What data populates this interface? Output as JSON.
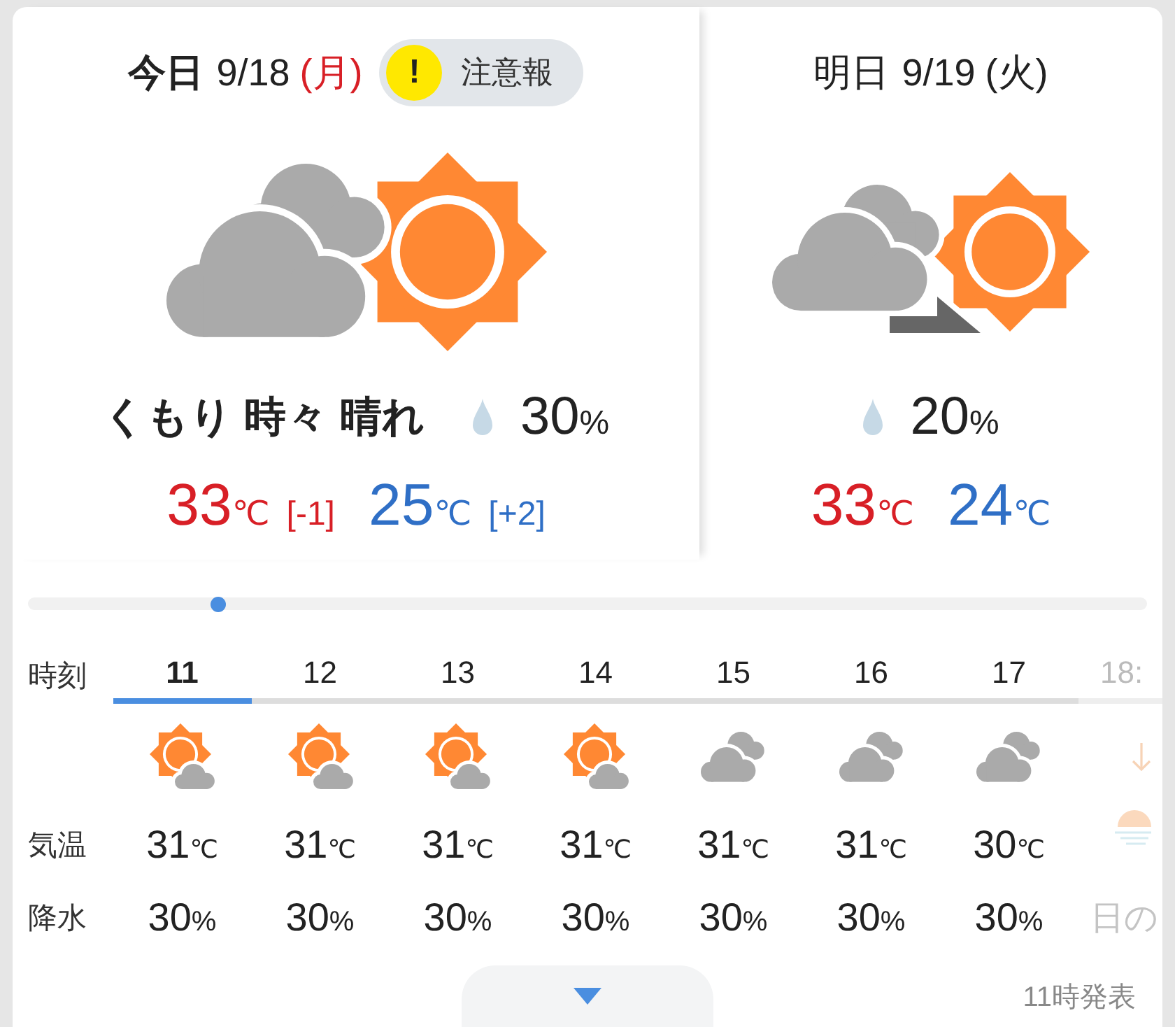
{
  "days": [
    {
      "label": "今日",
      "date": "9/18",
      "weekday": "(月)",
      "holiday": true,
      "selected": true,
      "alert": {
        "mark": "!",
        "label": "注意報"
      },
      "kind": "sometimes",
      "description": "くもり 時々 晴れ",
      "precip": {
        "value": "30",
        "unit": "%"
      },
      "high": {
        "value": "33",
        "unit": "℃",
        "diff": "[-1]"
      },
      "low": {
        "value": "25",
        "unit": "℃",
        "diff": "[+2]"
      }
    },
    {
      "label": "明日",
      "date": "9/19",
      "weekday": "(火)",
      "holiday": false,
      "selected": false,
      "kind": "later",
      "precip": {
        "value": "20",
        "unit": "%"
      },
      "high": {
        "value": "33",
        "unit": "℃"
      },
      "low": {
        "value": "24",
        "unit": "℃"
      }
    }
  ],
  "timeline_slider": {
    "level": 0.17
  },
  "hourly": {
    "row_labels": [
      "時刻",
      "気温",
      "降水"
    ],
    "hours": [
      {
        "kind": "fair",
        "time": "11",
        "selected": true,
        "temp": {
          "value": "31",
          "unit": "℃"
        },
        "precip": {
          "value": "30",
          "unit": "%"
        }
      },
      {
        "kind": "fair",
        "time": "12",
        "selected": false,
        "temp": {
          "value": "31",
          "unit": "℃"
        },
        "precip": {
          "value": "30",
          "unit": "%"
        }
      },
      {
        "kind": "fair",
        "time": "13",
        "selected": false,
        "temp": {
          "value": "31",
          "unit": "℃"
        },
        "precip": {
          "value": "30",
          "unit": "%"
        }
      },
      {
        "kind": "fair",
        "time": "14",
        "selected": false,
        "temp": {
          "value": "31",
          "unit": "℃"
        },
        "precip": {
          "value": "30",
          "unit": "%"
        }
      },
      {
        "kind": "cloudy",
        "time": "15",
        "selected": false,
        "temp": {
          "value": "31",
          "unit": "℃"
        },
        "precip": {
          "value": "30",
          "unit": "%"
        }
      },
      {
        "kind": "cloudy",
        "time": "16",
        "selected": false,
        "temp": {
          "value": "31",
          "unit": "℃"
        },
        "precip": {
          "value": "30",
          "unit": "%"
        }
      },
      {
        "kind": "cloudy",
        "time": "17",
        "selected": false,
        "temp": {
          "value": "30",
          "unit": "℃"
        },
        "precip": {
          "value": "30",
          "unit": "%"
        }
      },
      {
        "kind": "sunset",
        "time": "18:",
        "selected": false,
        "note": "日の"
      }
    ]
  },
  "footer": {
    "issued": "11時発表"
  }
}
